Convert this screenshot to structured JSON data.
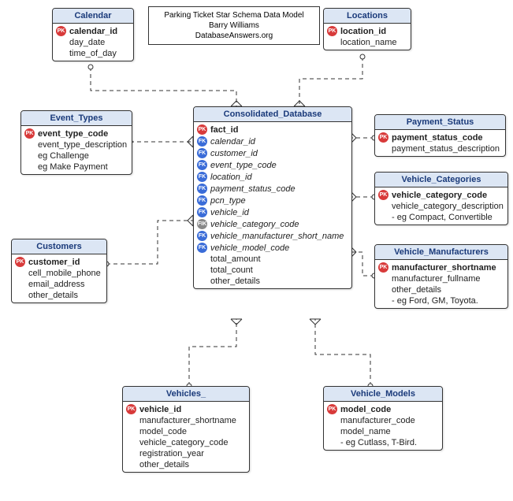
{
  "title": {
    "line1": "Parking Ticket Star Schema Data Model",
    "line2": "Barry Williams",
    "line3": "DatabaseAnswers.org"
  },
  "entities": {
    "calendar": {
      "name": "Calendar",
      "attrs": [
        {
          "key": "PK",
          "label": "calendar_id",
          "bold": true
        },
        {
          "key": "",
          "label": "day_date"
        },
        {
          "key": "",
          "label": "time_of_day"
        }
      ]
    },
    "locations": {
      "name": "Locations",
      "attrs": [
        {
          "key": "PK",
          "label": "location_id",
          "bold": true
        },
        {
          "key": "",
          "label": "location_name"
        }
      ]
    },
    "event_types": {
      "name": "Event_Types",
      "attrs": [
        {
          "key": "PK",
          "label": "event_type_code",
          "bold": true
        },
        {
          "key": "",
          "label": "event_type_description"
        },
        {
          "key": "",
          "label": "eg Challenge"
        },
        {
          "key": "",
          "label": "eg Make Payment"
        }
      ]
    },
    "consolidated": {
      "name": "Consolidated_Database",
      "attrs": [
        {
          "key": "PK",
          "label": "fact_id",
          "bold": true
        },
        {
          "key": "FK",
          "label": "calendar_id",
          "italic": true
        },
        {
          "key": "FK",
          "label": "customer_id",
          "italic": true
        },
        {
          "key": "FK",
          "label": "event_type_code",
          "italic": true
        },
        {
          "key": "FK",
          "label": "location_id",
          "italic": true
        },
        {
          "key": "FK",
          "label": "payment_status_code",
          "italic": true
        },
        {
          "key": "FK",
          "label": "pcn_type",
          "italic": true
        },
        {
          "key": "FK",
          "label": "vehicle_id",
          "italic": true
        },
        {
          "key": "FIK",
          "label": "vehicle_category_code",
          "italic": true
        },
        {
          "key": "FK",
          "label": "vehicle_manufacturer_short_name",
          "italic": true
        },
        {
          "key": "FK",
          "label": "vehicle_model_code",
          "italic": true
        },
        {
          "key": "",
          "label": "total_amount"
        },
        {
          "key": "",
          "label": "total_count"
        },
        {
          "key": "",
          "label": "other_details"
        }
      ]
    },
    "payment_status": {
      "name": "Payment_Status",
      "attrs": [
        {
          "key": "PK",
          "label": "payment_status_code",
          "bold": true
        },
        {
          "key": "",
          "label": "payment_status_description"
        }
      ]
    },
    "vehicle_categories": {
      "name": "Vehicle_Categories",
      "attrs": [
        {
          "key": "PK",
          "label": "vehicle_category_code",
          "bold": true
        },
        {
          "key": "",
          "label": "vehicle_category_description"
        },
        {
          "key": "",
          "label": "- eg Compact, Convertible"
        }
      ]
    },
    "customers": {
      "name": "Customers",
      "attrs": [
        {
          "key": "PK",
          "label": "customer_id",
          "bold": true
        },
        {
          "key": "",
          "label": "cell_mobile_phone"
        },
        {
          "key": "",
          "label": "email_address"
        },
        {
          "key": "",
          "label": "other_details"
        }
      ]
    },
    "vehicle_manufacturers": {
      "name": "Vehicle_Manufacturers",
      "attrs": [
        {
          "key": "PK",
          "label": "manufacturer_shortname",
          "bold": true
        },
        {
          "key": "",
          "label": "manufacturer_fullname"
        },
        {
          "key": "",
          "label": "other_details"
        },
        {
          "key": "",
          "label": "- eg Ford, GM, Toyota."
        }
      ]
    },
    "vehicles": {
      "name": "Vehicles_",
      "attrs": [
        {
          "key": "PK",
          "label": "vehicle_id",
          "bold": true
        },
        {
          "key": "",
          "label": "manufacturer_shortname"
        },
        {
          "key": "",
          "label": "model_code"
        },
        {
          "key": "",
          "label": "vehicle_category_code"
        },
        {
          "key": "",
          "label": "registration_year"
        },
        {
          "key": "",
          "label": "other_details"
        }
      ]
    },
    "vehicle_models": {
      "name": "Vehicle_Models",
      "attrs": [
        {
          "key": "PK",
          "label": "model_code",
          "bold": true
        },
        {
          "key": "",
          "label": "manufacturer_code"
        },
        {
          "key": "",
          "label": "model_name"
        },
        {
          "key": "",
          "label": "- eg Cutlass, T-Bird."
        }
      ]
    }
  }
}
